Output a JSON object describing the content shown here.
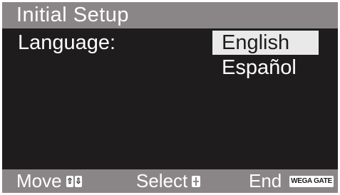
{
  "header": {
    "title": "Initial Setup"
  },
  "setting": {
    "label": "Language:",
    "options": [
      {
        "label": "English",
        "selected": true
      },
      {
        "label": "Español",
        "selected": false
      }
    ]
  },
  "footer": {
    "move_label": "Move",
    "move_keys": [
      "⇧",
      "⇩"
    ],
    "select_label": "Select",
    "end_label": "End",
    "end_key_label": "WEGA GATE"
  },
  "colors": {
    "screen_bg": "#1e1c1d",
    "bar_bg": "#8a8688",
    "highlight_bg": "#e9e9e9",
    "text": "#ffffff"
  },
  "icons": {
    "move": "up-down-arrows-icon",
    "select": "select-button-icon",
    "end": "wega-gate-button-icon"
  }
}
